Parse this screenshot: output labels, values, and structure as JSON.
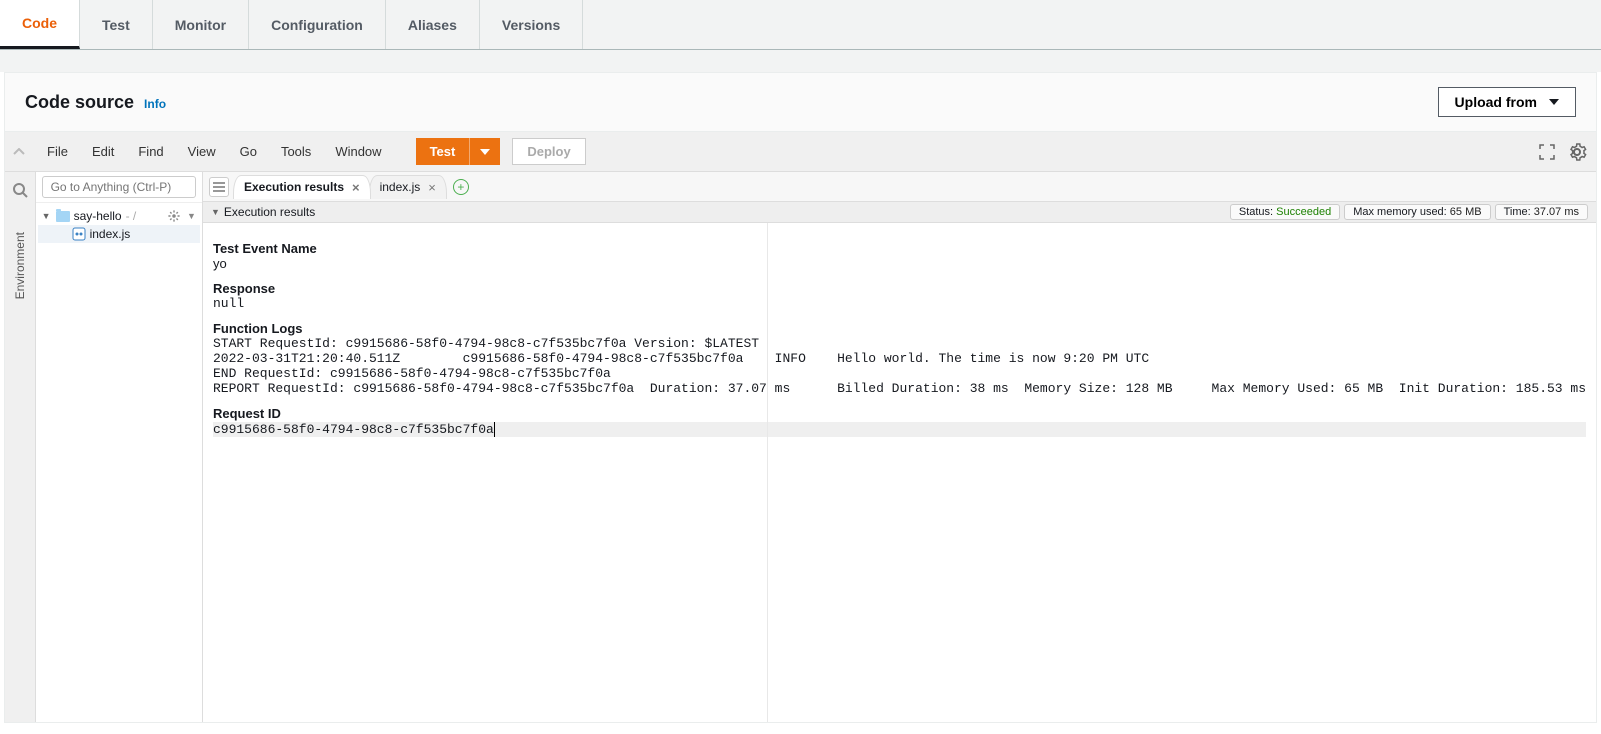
{
  "tabs": {
    "code": "Code",
    "test": "Test",
    "monitor": "Monitor",
    "configuration": "Configuration",
    "aliases": "Aliases",
    "versions": "Versions"
  },
  "panel": {
    "title": "Code source",
    "info": "Info",
    "upload": "Upload from"
  },
  "menubar": {
    "file": "File",
    "edit": "Edit",
    "find": "Find",
    "view": "View",
    "go": "Go",
    "tools": "Tools",
    "window": "Window",
    "test": "Test",
    "deploy": "Deploy"
  },
  "sidebar": {
    "search_placeholder": "Go to Anything (Ctrl-P)",
    "rail": "Environment",
    "root": "say-hello",
    "root_suffix": " - /",
    "file": "index.js"
  },
  "editor_tabs": {
    "results": "Execution results",
    "file": "index.js"
  },
  "exec": {
    "header": "Execution results",
    "status_label": "Status: ",
    "status_value": "Succeeded",
    "mem_label": "Max memory used: ",
    "mem_value": "65 MB",
    "time_label": "Time: ",
    "time_value": "37.07 ms"
  },
  "results": {
    "test_event_label": "Test Event Name",
    "test_event_name": "yo",
    "response_label": "Response",
    "response_value": "null",
    "logs_label": "Function Logs",
    "logs": "START RequestId: c9915686-58f0-4794-98c8-c7f535bc7f0a Version: $LATEST\n2022-03-31T21:20:40.511Z\tc9915686-58f0-4794-98c8-c7f535bc7f0a\tINFO\tHello world. The time is now 9:20 PM UTC\nEND RequestId: c9915686-58f0-4794-98c8-c7f535bc7f0a\nREPORT RequestId: c9915686-58f0-4794-98c8-c7f535bc7f0a\tDuration: 37.07 ms\tBilled Duration: 38 ms\tMemory Size: 128 MB\tMax Memory Used: 65 MB\tInit Duration: 185.53 ms",
    "request_id_label": "Request ID",
    "request_id": "c9915686-58f0-4794-98c8-c7f535bc7f0a"
  }
}
